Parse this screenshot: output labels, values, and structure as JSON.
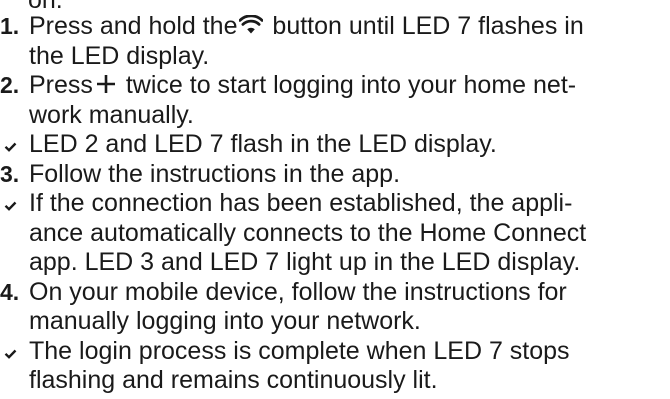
{
  "top_fragment": "on.",
  "steps": [
    {
      "kind": "step",
      "marker": "1.",
      "lines": [
        "Press and hold the",
        " button until LED 7 flashes in",
        "the LED display."
      ],
      "icon": "wifi-icon"
    },
    {
      "kind": "step",
      "marker": "2.",
      "lines": [
        "Press",
        " twice to start logging into your home net-",
        "work manually."
      ],
      "icon": "plus-icon"
    },
    {
      "kind": "result",
      "marker": "checkmark-icon",
      "lines": [
        "LED 2 and LED 7 flash in the LED display."
      ]
    },
    {
      "kind": "step",
      "marker": "3.",
      "lines": [
        "Follow the instructions in the app."
      ]
    },
    {
      "kind": "result",
      "marker": "checkmark-icon",
      "lines": [
        "If the connection has been established, the appli-",
        "ance automatically connects to the Home Connect",
        "app. LED 3 and LED 7 light up in the LED display."
      ]
    },
    {
      "kind": "step",
      "marker": "4.",
      "lines": [
        "On your mobile device, follow the instructions for",
        "manually logging into your network."
      ]
    },
    {
      "kind": "result",
      "marker": "checkmark-icon",
      "lines": [
        "The login process is complete when LED 7 stops",
        "flashing and remains continuously lit."
      ]
    }
  ]
}
